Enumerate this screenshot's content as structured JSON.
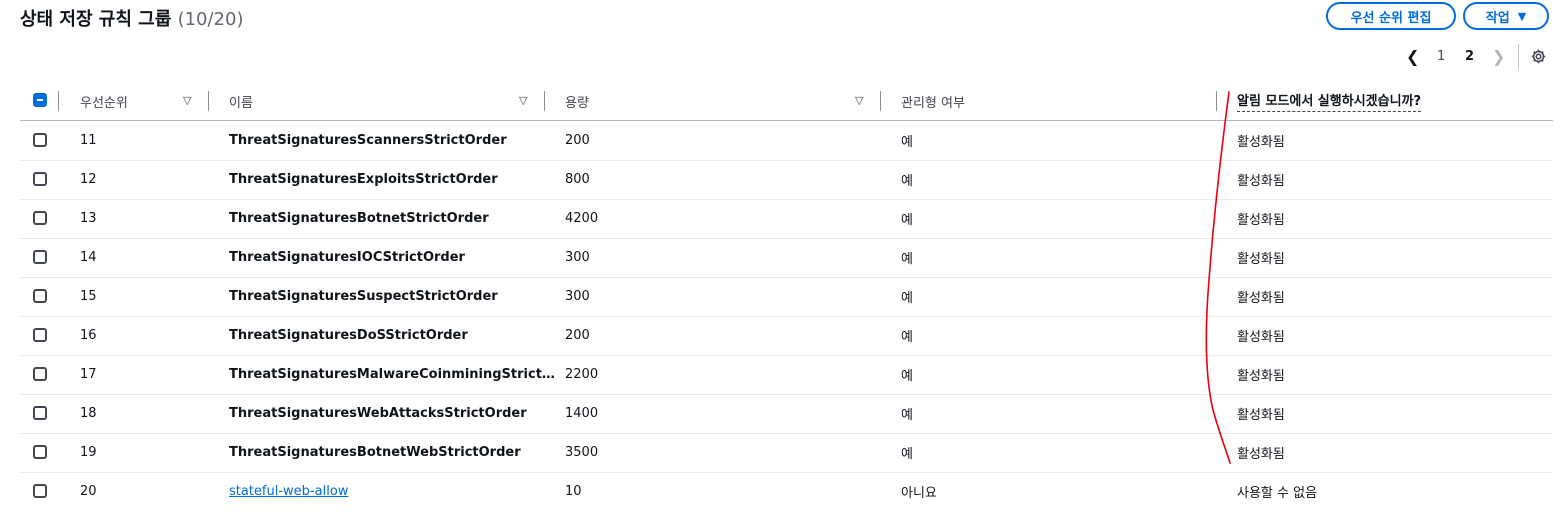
{
  "title": {
    "text": "상태 저장 규칙 그룹",
    "count": "(10/20)"
  },
  "buttons": {
    "edit_priority": "우선 순위 편집",
    "actions": "작업",
    "actions_caret": "▼"
  },
  "pagination": {
    "prev": "❮",
    "pages": [
      "1",
      "2"
    ],
    "current": "2",
    "next": "❯"
  },
  "columns": {
    "priority": "우선순위",
    "name": "이름",
    "capacity": "용량",
    "managed": "관리형 여부",
    "alert_mode": "알림 모드에서 실행하시겠습니까?"
  },
  "sort_glyph": "▽",
  "rows": [
    {
      "priority": "11",
      "name": "ThreatSignaturesScannersStrictOrder",
      "capacity": "200",
      "managed": "예",
      "alert": "활성화됨",
      "link": false
    },
    {
      "priority": "12",
      "name": "ThreatSignaturesExploitsStrictOrder",
      "capacity": "800",
      "managed": "예",
      "alert": "활성화됨",
      "link": false
    },
    {
      "priority": "13",
      "name": "ThreatSignaturesBotnetStrictOrder",
      "capacity": "4200",
      "managed": "예",
      "alert": "활성화됨",
      "link": false
    },
    {
      "priority": "14",
      "name": "ThreatSignaturesIOCStrictOrder",
      "capacity": "300",
      "managed": "예",
      "alert": "활성화됨",
      "link": false
    },
    {
      "priority": "15",
      "name": "ThreatSignaturesSuspectStrictOrder",
      "capacity": "300",
      "managed": "예",
      "alert": "활성화됨",
      "link": false
    },
    {
      "priority": "16",
      "name": "ThreatSignaturesDoSStrictOrder",
      "capacity": "200",
      "managed": "예",
      "alert": "활성화됨",
      "link": false
    },
    {
      "priority": "17",
      "name": "ThreatSignaturesMalwareCoinminingStrict…",
      "capacity": "2200",
      "managed": "예",
      "alert": "활성화됨",
      "link": false
    },
    {
      "priority": "18",
      "name": "ThreatSignaturesWebAttacksStrictOrder",
      "capacity": "1400",
      "managed": "예",
      "alert": "활성화됨",
      "link": false
    },
    {
      "priority": "19",
      "name": "ThreatSignaturesBotnetWebStrictOrder",
      "capacity": "3500",
      "managed": "예",
      "alert": "활성화됨",
      "link": false
    },
    {
      "priority": "20",
      "name": "stateful-web-allow",
      "capacity": "10",
      "managed": "아니요",
      "alert": "사용할 수 없음",
      "link": true
    }
  ],
  "colors": {
    "accent": "#006ce0",
    "annotation": "#e8000b"
  }
}
